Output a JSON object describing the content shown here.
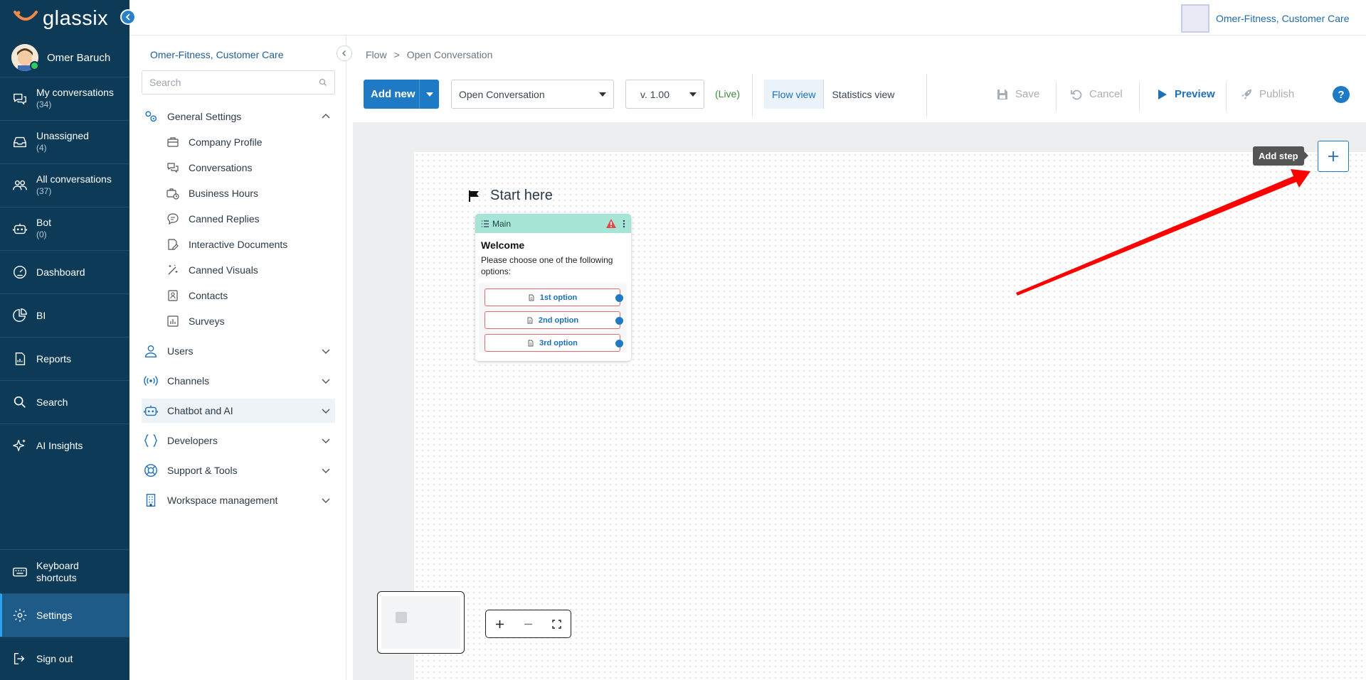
{
  "app": {
    "logo_text": "glassix"
  },
  "workspace": {
    "name": "Omer-Fitness, Customer Care"
  },
  "user": {
    "name": "Omer Baruch"
  },
  "nav": {
    "my_conversations": {
      "label": "My conversations",
      "count": "(34)"
    },
    "unassigned": {
      "label": "Unassigned",
      "count": "(4)"
    },
    "all_conversations": {
      "label": "All conversations",
      "count": "(37)"
    },
    "bot": {
      "label": "Bot",
      "count": "(0)"
    },
    "dashboard": "Dashboard",
    "bi": "BI",
    "reports": "Reports",
    "search": "Search",
    "ai_insights": "AI Insights",
    "keyboard_shortcuts_line1": "Keyboard",
    "keyboard_shortcuts_line2": "shortcuts",
    "settings": "Settings",
    "sign_out": "Sign out"
  },
  "settings_panel": {
    "org_title": "Omer-Fitness, Customer Care",
    "search_placeholder": "Search",
    "general_settings": "General Settings",
    "sub": {
      "company_profile": "Company Profile",
      "conversations": "Conversations",
      "business_hours": "Business Hours",
      "canned_replies": "Canned Replies",
      "interactive_documents": "Interactive Documents",
      "canned_visuals": "Canned Visuals",
      "contacts": "Contacts",
      "surveys": "Surveys"
    },
    "users": "Users",
    "channels": "Channels",
    "chatbot_ai": "Chatbot and AI",
    "developers": "Developers",
    "support_tools": "Support & Tools",
    "workspace_management": "Workspace management"
  },
  "breadcrumb": {
    "root": "Flow",
    "sep": ">",
    "current": "Open Conversation"
  },
  "toolbar": {
    "add_new": "Add new",
    "flow_select": "Open Conversation",
    "version_select": "v. 1.00",
    "live": "(Live)",
    "flow_view": "Flow view",
    "statistics_view": "Statistics view",
    "save": "Save",
    "cancel": "Cancel",
    "preview": "Preview",
    "publish": "Publish",
    "help": "?"
  },
  "canvas": {
    "start_label": "Start here",
    "add_step_tooltip": "Add step",
    "node": {
      "header": "Main",
      "title": "Welcome",
      "message": "Please choose one of the following options:",
      "options": [
        "1st option",
        "2nd option",
        "3rd option"
      ]
    }
  },
  "colors": {
    "nav_bg": "#0d3b57",
    "accent": "#1e7ac5",
    "node_header": "#a6e4d6",
    "option_border": "#e36b6b",
    "arrow": "#ff0000"
  }
}
